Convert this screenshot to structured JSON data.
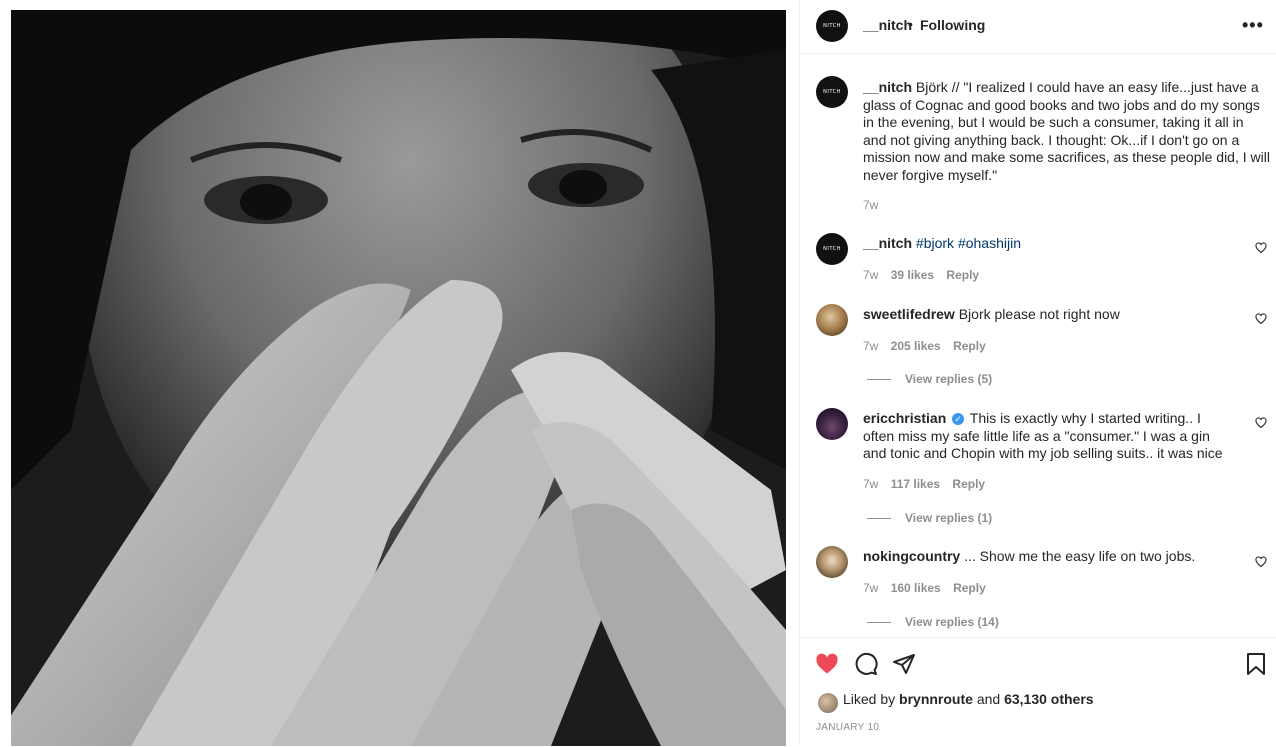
{
  "header": {
    "username": "__nitch",
    "dot": "•",
    "follow_state": "Following",
    "more": "•••",
    "avatar_text": "NITCH"
  },
  "caption": {
    "username": "__nitch",
    "text": "Björk // \"I realized I could have an easy life...just have a glass of Cognac and good books and two jobs and do my songs in the evening, but I would be such a consumer, taking it all in and not giving anything back. I thought: Ok...if I don't go on a mission now and make some sacrifices, as these people did, I will never forgive myself.\"",
    "time": "7w"
  },
  "comments": [
    {
      "username": "__nitch",
      "text": "",
      "tags": [
        "#bjork",
        "#ohashijin"
      ],
      "time": "7w",
      "likes": "39 likes",
      "reply": "Reply"
    },
    {
      "username": "sweetlifedrew",
      "text": "Bjork please not right now",
      "time": "7w",
      "likes": "205 likes",
      "reply": "Reply",
      "view_replies": "View replies (5)"
    },
    {
      "username": "ericchristian",
      "verified": true,
      "text": "This is exactly why I started writing.. I often miss my safe little life as a \"consumer.\" I was a gin and tonic and Chopin with my job selling suits.. it was nice",
      "time": "7w",
      "likes": "117 likes",
      "reply": "Reply",
      "view_replies": "View replies (1)"
    },
    {
      "username": "nokingcountry",
      "text": "... Show me the easy life on two jobs.",
      "time": "7w",
      "likes": "160 likes",
      "reply": "Reply",
      "view_replies": "View replies (14)"
    }
  ],
  "actions": {
    "liked_prefix": "Liked by",
    "liked_user": "brynnroute",
    "liked_and": "and",
    "liked_others": "63,130 others",
    "date": "JANUARY 10"
  },
  "colors": {
    "like_red": "#ed4956",
    "link_blue": "#00376b",
    "muted": "#8e8e8e",
    "verified_blue": "#3897f0"
  }
}
